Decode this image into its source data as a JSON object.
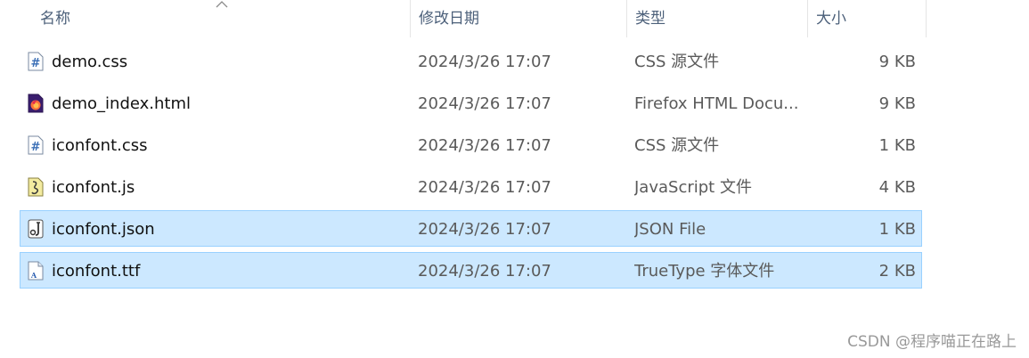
{
  "header": {
    "name": "名称",
    "date": "修改日期",
    "type": "类型",
    "size": "大小"
  },
  "files": [
    {
      "name": "demo.css",
      "date": "2024/3/26 17:07",
      "type": "CSS 源文件",
      "size": "9 KB",
      "icon": "css-file-icon",
      "selected": false
    },
    {
      "name": "demo_index.html",
      "date": "2024/3/26 17:07",
      "type": "Firefox HTML Docu...",
      "size": "9 KB",
      "icon": "firefox-html-file-icon",
      "selected": false
    },
    {
      "name": "iconfont.css",
      "date": "2024/3/26 17:07",
      "type": "CSS 源文件",
      "size": "1 KB",
      "icon": "css-file-icon",
      "selected": false
    },
    {
      "name": "iconfont.js",
      "date": "2024/3/26 17:07",
      "type": "JavaScript 文件",
      "size": "4 KB",
      "icon": "js-file-icon",
      "selected": false
    },
    {
      "name": "iconfont.json",
      "date": "2024/3/26 17:07",
      "type": "JSON File",
      "size": "1 KB",
      "icon": "json-file-icon",
      "selected": true
    },
    {
      "name": "iconfont.ttf",
      "date": "2024/3/26 17:07",
      "type": "TrueType 字体文件",
      "size": "2 KB",
      "icon": "ttf-file-icon",
      "selected": true
    }
  ],
  "watermark": "CSDN @程序喵正在路上",
  "colors": {
    "selection_bg": "#cce8ff",
    "selection_border": "#99d1ff",
    "header_text": "#4c607a"
  }
}
